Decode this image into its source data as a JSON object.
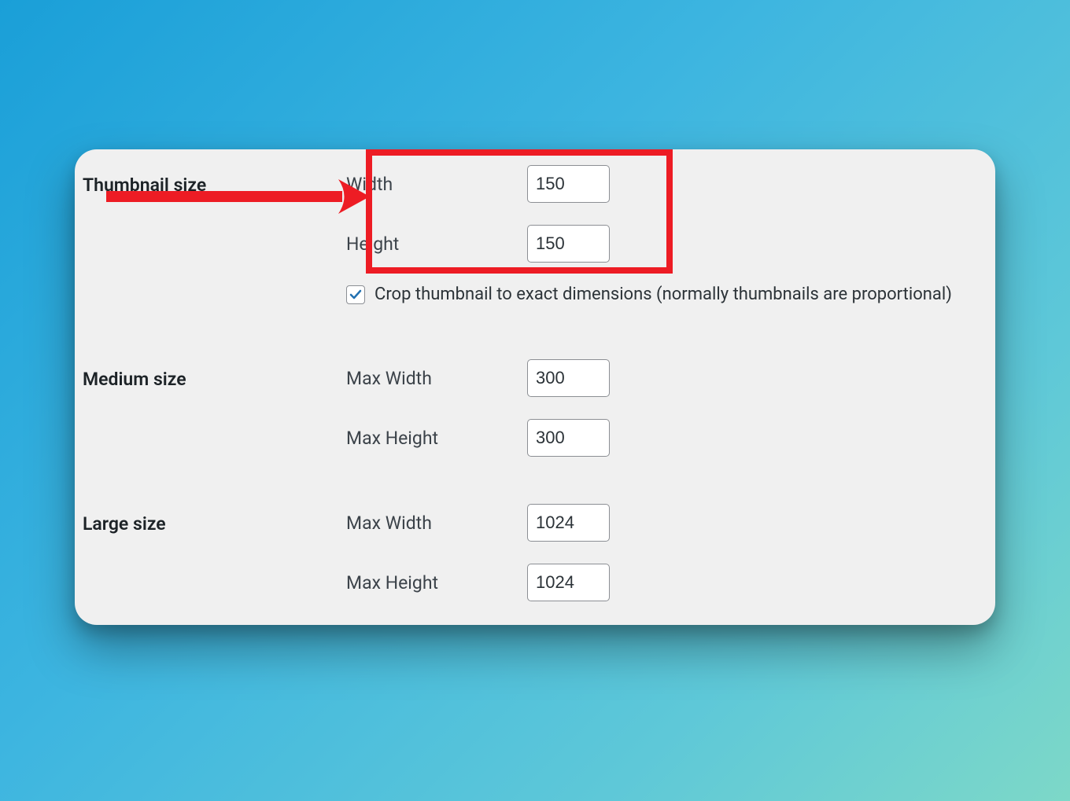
{
  "sections": {
    "thumbnail": {
      "title": "Thumbnail size",
      "width_label": "Width",
      "width_value": "150",
      "height_label": "Height",
      "height_value": "150",
      "crop_checked": true,
      "crop_label": "Crop thumbnail to exact dimensions (normally thumbnails are proportional)"
    },
    "medium": {
      "title": "Medium size",
      "max_width_label": "Max Width",
      "max_width_value": "300",
      "max_height_label": "Max Height",
      "max_height_value": "300"
    },
    "large": {
      "title": "Large size",
      "max_width_label": "Max Width",
      "max_width_value": "1024",
      "max_height_label": "Max Height",
      "max_height_value": "1024"
    }
  },
  "annotation": {
    "highlight_color": "#ed1c24"
  }
}
